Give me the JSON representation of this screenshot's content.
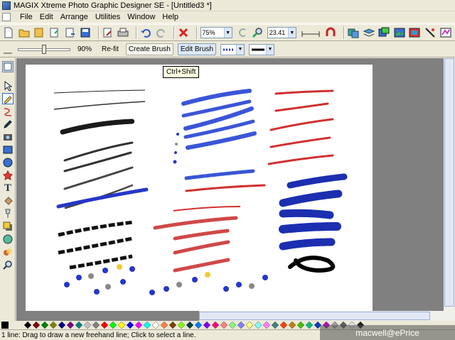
{
  "window": {
    "title": "MAGIX Xtreme Photo Graphic Designer SE - [Untitled3 *]"
  },
  "menu": [
    {
      "label": "File"
    },
    {
      "label": "Edit"
    },
    {
      "label": "Arrange"
    },
    {
      "label": "Utilities"
    },
    {
      "label": "Window"
    },
    {
      "label": "Help"
    }
  ],
  "toolbar": {
    "zoom_value": "75%",
    "size_value": "23.41"
  },
  "infobar": {
    "brush_percent": "90%",
    "refit_label": "Re-fit",
    "create_brush_label": "Create Brush",
    "edit_brush_label": "Edit Brush"
  },
  "tooltip": {
    "text": "Ctrl+Shift"
  },
  "status": {
    "text": "1 line: Drag to draw a new freehand line; Click to select a line."
  },
  "watermark": {
    "text": "macwell@ePrice"
  },
  "palette_colors": [
    "#000000",
    "#800000",
    "#008000",
    "#808000",
    "#000080",
    "#800080",
    "#008080",
    "#c0c0c0",
    "#808080",
    "#ff0000",
    "#00ff00",
    "#ffff00",
    "#0000ff",
    "#ff00ff",
    "#00ffff",
    "#ffffff",
    "#ff8040",
    "#804000",
    "#80ff00",
    "#004040",
    "#0080ff",
    "#8000ff",
    "#ff0080",
    "#ff8080",
    "#80ff80",
    "#8080ff",
    "#ffff80",
    "#80ffff",
    "#ff80ff",
    "#408080",
    "#ff4000",
    "#c08000",
    "#40c000",
    "#00c080",
    "#0040c0",
    "#c000c0",
    "#a0a0a0",
    "#606060",
    "#e0e0e0",
    "#202020"
  ]
}
